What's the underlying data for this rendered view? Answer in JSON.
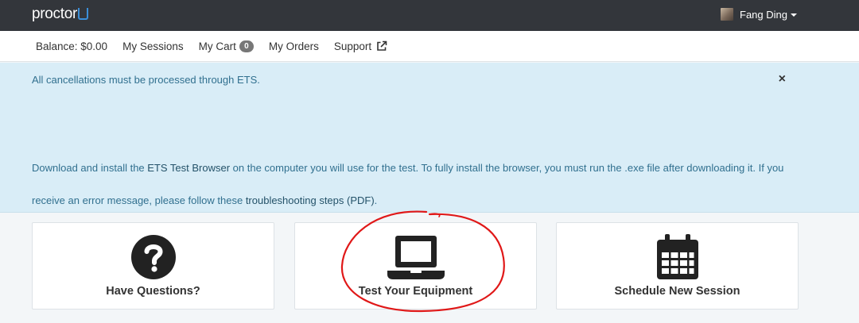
{
  "header": {
    "logo_text": "proctor",
    "user_name": "Fang Ding"
  },
  "nav": {
    "balance": "Balance: $0.00",
    "sessions": "My Sessions",
    "cart": "My Cart",
    "cart_count": "0",
    "orders": "My Orders",
    "support": "Support"
  },
  "alert": {
    "line1": "All cancellations must be processed through ETS.",
    "close": "×",
    "p1": "Download and install the ",
    "link1": "ETS Test Browser",
    "p2": " on the computer you will use for the test. To fully install the browser, you must run the .exe file after downloading it. If you receive an error message, please follow these ",
    "link2": "troubleshooting steps (PDF)",
    "p3": "."
  },
  "cards": [
    {
      "label": "Have Questions?",
      "icon": "question-circle-icon"
    },
    {
      "label": "Test Your Equipment",
      "icon": "laptop-icon"
    },
    {
      "label": "Schedule New Session",
      "icon": "calendar-icon"
    }
  ],
  "colors": {
    "topbar": "#33363b",
    "alert_bg": "#d9edf7",
    "alert_text": "#31708f",
    "logo_accent": "#3b8fd9",
    "annotation_red": "#e01818"
  }
}
